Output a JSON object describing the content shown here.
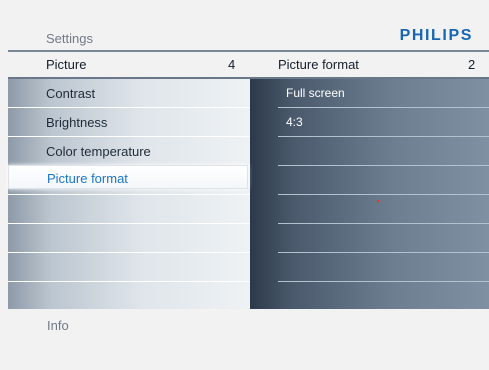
{
  "header": {
    "title": "Settings",
    "brand": "PHILIPS"
  },
  "left_list": {
    "title": "Picture",
    "count": "4",
    "items": [
      "Contrast",
      "Brightness",
      "Color temperature",
      "Picture format"
    ],
    "selected": "Picture format"
  },
  "right_list": {
    "title": "Picture format",
    "count": "2",
    "items": [
      "Full screen",
      "4:3"
    ]
  },
  "footer": {
    "info": "Info"
  },
  "colors": {
    "brand": "#1666b4",
    "selected_text": "#1976c8",
    "header_text": "#6f7a86"
  }
}
